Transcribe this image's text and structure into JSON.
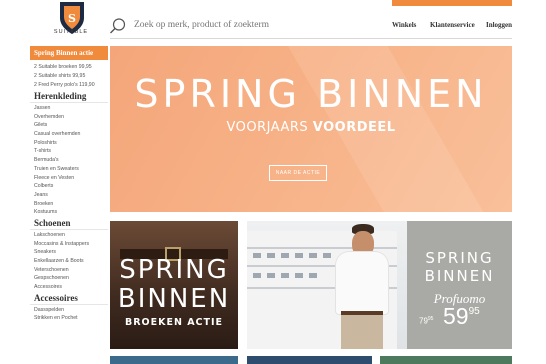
{
  "header": {
    "logo_text": "SUITABLE",
    "search": {
      "placeholder": "Zoek op merk, product of zoekterm"
    },
    "nav": [
      "Winkels",
      "Klantenservice",
      "Inloggen"
    ]
  },
  "sidebar": {
    "promo_heading": "Spring Binnen actie",
    "promos": [
      "2 Suitable broeken 99,95",
      "2 Suitable shirts 99,95",
      "2 Fred Perry polo's 119,90"
    ],
    "categories": [
      {
        "title": "Herenkleding",
        "items": [
          "Jassen",
          "Overhemden",
          "Gilets",
          "Casual overhemden",
          "Poloshirts",
          "T-shirts",
          "Bermuda's",
          "Truien en Sweaters",
          "Fleece en Vesten",
          "Colberts",
          "Jeans",
          "Broeken",
          "Kostuums"
        ]
      },
      {
        "title": "Schoenen",
        "items": [
          "Lakschoenen",
          "Moccasins & Instappers",
          "Sneakers",
          "Enkellaarzen & Boots",
          "Veterschoenen",
          "Gespschoenen",
          "Accessoires"
        ]
      },
      {
        "title": "Accessoires",
        "items": [
          "Dassspelden",
          "Strikken en Pochet"
        ]
      }
    ]
  },
  "hero": {
    "title": "SPRING BINNEN",
    "subtitle_light": "VOORJAARS",
    "subtitle_bold": "VOORDEEL",
    "button": "NAAR DE ACTIE"
  },
  "tile_left": {
    "line1": "SPRING",
    "line2": "BINNEN",
    "subtitle": "BROEKEN ACTIE"
  },
  "tile_right": {
    "line1": "SPRING",
    "line2": "BINNEN",
    "brand": "Profuomo",
    "old_price_main": "79",
    "old_price_cents": "95",
    "new_price_main": "59",
    "new_price_cents": "95"
  },
  "colors": {
    "accent": "#f08a3c",
    "hero_bg": "#f7b186"
  }
}
